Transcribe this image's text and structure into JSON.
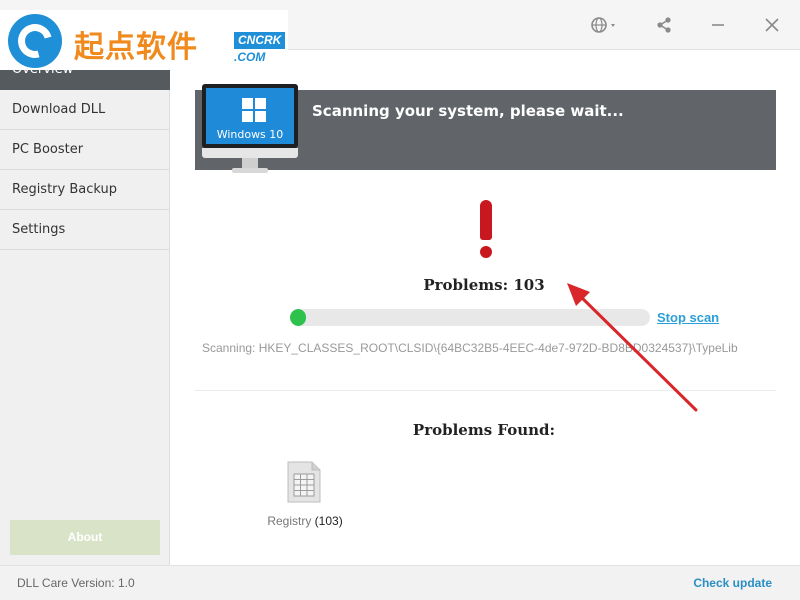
{
  "watermark": {
    "text": "起点软件",
    "badge": "CNCRK",
    "domain": ".COM"
  },
  "titlebar": {
    "icons": [
      "globe-icon",
      "share-icon",
      "minimize-icon",
      "close-icon"
    ]
  },
  "sidebar": {
    "items": [
      {
        "label": "Overview",
        "active": true
      },
      {
        "label": "Download DLL",
        "active": false
      },
      {
        "label": "PC Booster",
        "active": false
      },
      {
        "label": "Registry Backup",
        "active": false
      },
      {
        "label": "Settings",
        "active": false
      }
    ],
    "about_label": "About"
  },
  "banner": {
    "title": "Scanning your system, please wait...",
    "os_label": "Windows 10"
  },
  "scan": {
    "problems_label": "Problems: 103",
    "progress_fraction": 0.04,
    "stop_label": "Stop scan",
    "path": "Scanning: HKEY_CLASSES_ROOT\\CLSID\\{64BC32B5-4EEC-4de7-972D-BD8BD0324537}\\TypeLib"
  },
  "found": {
    "title": "Problems Found:",
    "registry_label": "Registry",
    "registry_count": "(103)"
  },
  "footer": {
    "version": "DLL Care Version: 1.0",
    "check_update": "Check update"
  },
  "colors": {
    "sidebar_active": "#555a5e",
    "banner_bg": "#616569",
    "progress": "#2ec24d",
    "exclaim": "#c8171e",
    "link": "#2a9fd8",
    "arrow": "#d8262b"
  }
}
